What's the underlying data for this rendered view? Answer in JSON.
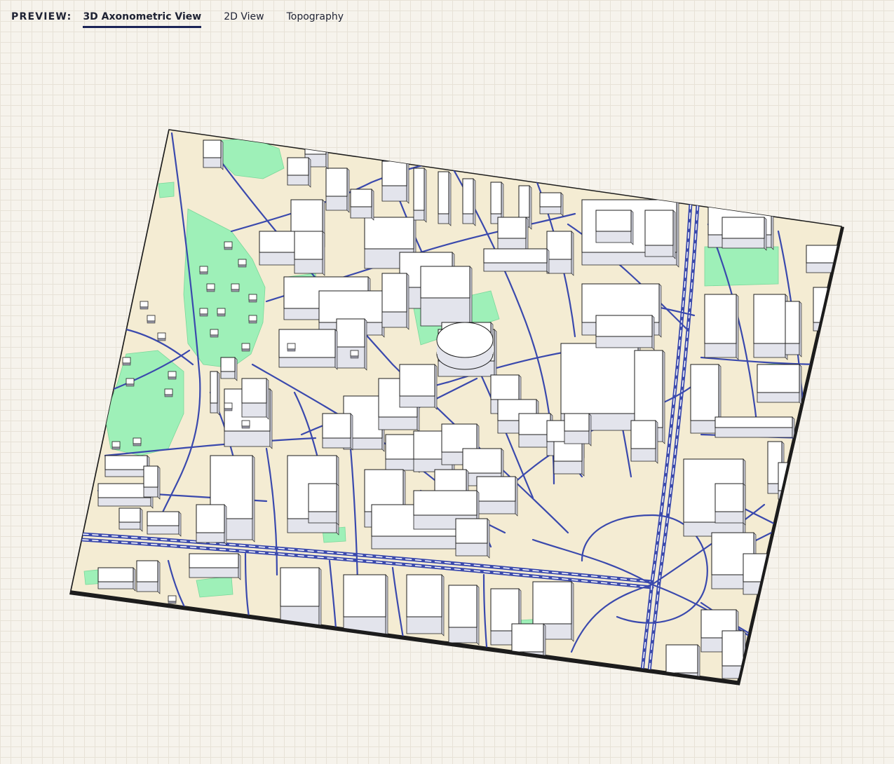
{
  "header": {
    "preview_label": "PREVIEW:",
    "tabs": [
      {
        "label": "3D Axonometric View",
        "active": true
      },
      {
        "label": "2D View",
        "active": false
      },
      {
        "label": "Topography",
        "active": false
      }
    ]
  },
  "map": {
    "colors": {
      "ground": "#f4ecd3",
      "park": "#9ef0b8",
      "road": "#3a49ad",
      "building_top": "#ffffff",
      "building_side": "#e3e4ec",
      "outline": "#1c1c1c"
    }
  }
}
